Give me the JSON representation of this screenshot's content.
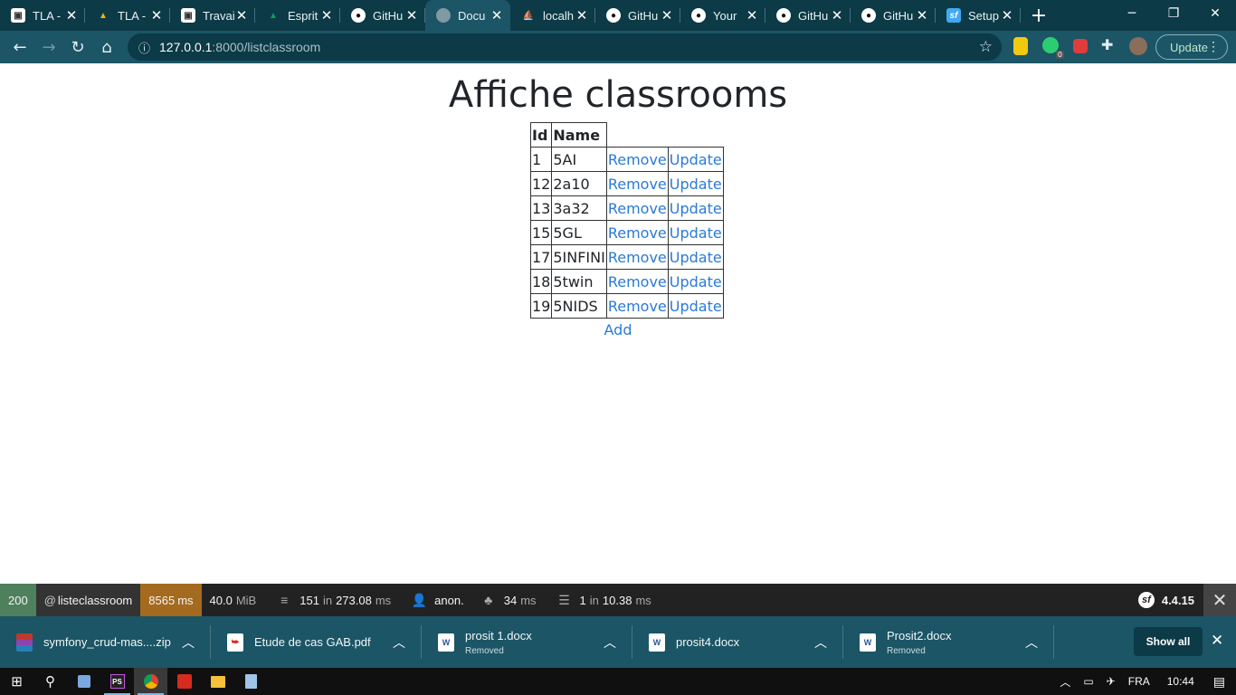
{
  "browser": {
    "tabs": [
      {
        "title": "TLA -",
        "icon": "classroom-icon",
        "active": false
      },
      {
        "title": "TLA -",
        "icon": "google-drive-icon",
        "active": false
      },
      {
        "title": "Travai",
        "icon": "classroom-icon",
        "active": false
      },
      {
        "title": "Esprit",
        "icon": "google-drive-icon",
        "active": false
      },
      {
        "title": "GitHu",
        "icon": "github-icon",
        "active": false
      },
      {
        "title": "Docu",
        "icon": "page-icon",
        "active": true
      },
      {
        "title": "localh",
        "icon": "phpmyadmin-icon",
        "active": false
      },
      {
        "title": "GitHu",
        "icon": "github-icon",
        "active": false
      },
      {
        "title": "Your",
        "icon": "github-icon",
        "active": false
      },
      {
        "title": "GitHu",
        "icon": "github-icon",
        "active": false
      },
      {
        "title": "GitHu",
        "icon": "github-icon",
        "active": false
      },
      {
        "title": "Setup",
        "icon": "symfony-icon",
        "active": false
      }
    ],
    "url_host": "127.0.0.1",
    "url_rest": ":8000/listclassroom",
    "update_label": "Update",
    "extension_badge": "0",
    "theme_color": "#1b5566"
  },
  "page": {
    "title": "Affiche classrooms",
    "table": {
      "headers": [
        "Id",
        "Name"
      ],
      "rows": [
        {
          "id": "1",
          "name": "5AI",
          "remove": "Remove",
          "update": "Update"
        },
        {
          "id": "12",
          "name": "2a10",
          "remove": "Remove",
          "update": "Update"
        },
        {
          "id": "13",
          "name": "3a32",
          "remove": "Remove",
          "update": "Update"
        },
        {
          "id": "15",
          "name": "5GL",
          "remove": "Remove",
          "update": "Update"
        },
        {
          "id": "17",
          "name": "5INFINI",
          "remove": "Remove",
          "update": "Update"
        },
        {
          "id": "18",
          "name": "5twin",
          "remove": "Remove",
          "update": "Update"
        },
        {
          "id": "19",
          "name": "5NIDS",
          "remove": "Remove",
          "update": "Update"
        }
      ]
    },
    "add_label": "Add",
    "link_color": "#2a7ad8"
  },
  "symfony_toolbar": {
    "status": "200",
    "route_prefix": "@",
    "route": "listeclassroom",
    "time": "8565",
    "time_unit": "ms",
    "memory": "40.0",
    "memory_unit": "MiB",
    "events": "151",
    "events_in": "in",
    "events_time": "273.08",
    "events_unit": "ms",
    "user": "anon.",
    "twig_time": "34",
    "twig_unit": "ms",
    "db_queries": "1",
    "db_in": "in",
    "db_time": "10.38",
    "db_unit": "ms",
    "version": "4.4.15"
  },
  "downloads": {
    "items": [
      {
        "name": "symfony_crud-mas....zip",
        "sub": "",
        "icon": "zip-icon"
      },
      {
        "name": "Etude de cas GAB.pdf",
        "sub": "",
        "icon": "pdf-icon"
      },
      {
        "name": "prosit 1.docx",
        "sub": "Removed",
        "icon": "word-icon"
      },
      {
        "name": "prosit4.docx",
        "sub": "",
        "icon": "word-icon"
      },
      {
        "name": "Prosit2.docx",
        "sub": "Removed",
        "icon": "word-icon"
      }
    ],
    "show_all": "Show all"
  },
  "taskbar": {
    "language": "FRA",
    "time": "10:44"
  }
}
